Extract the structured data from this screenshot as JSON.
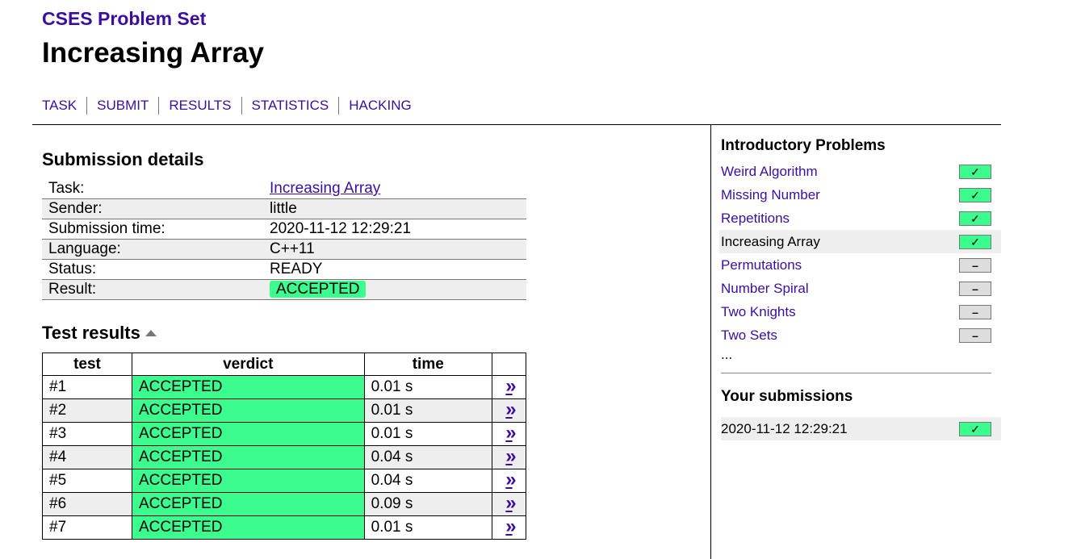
{
  "site": {
    "title": "CSES Problem Set"
  },
  "page": {
    "title": "Increasing Array"
  },
  "nav": [
    "TASK",
    "SUBMIT",
    "RESULTS",
    "STATISTICS",
    "HACKING"
  ],
  "submission": {
    "heading": "Submission details",
    "task_label": "Task:",
    "task_value": "Increasing Array",
    "sender_label": "Sender:",
    "sender_value": "little",
    "time_label": "Submission time:",
    "time_value": "2020-11-12 12:29:21",
    "language_label": "Language:",
    "language_value": "C++11",
    "status_label": "Status:",
    "status_value": "READY",
    "result_label": "Result:",
    "result_value": "ACCEPTED"
  },
  "tests": {
    "heading": "Test results",
    "columns": [
      "test",
      "verdict",
      "time"
    ],
    "rows": [
      {
        "test": "#1",
        "verdict": "ACCEPTED",
        "time": "0.01 s"
      },
      {
        "test": "#2",
        "verdict": "ACCEPTED",
        "time": "0.01 s"
      },
      {
        "test": "#3",
        "verdict": "ACCEPTED",
        "time": "0.01 s"
      },
      {
        "test": "#4",
        "verdict": "ACCEPTED",
        "time": "0.04 s"
      },
      {
        "test": "#5",
        "verdict": "ACCEPTED",
        "time": "0.04 s"
      },
      {
        "test": "#6",
        "verdict": "ACCEPTED",
        "time": "0.09 s"
      },
      {
        "test": "#7",
        "verdict": "ACCEPTED",
        "time": "0.01 s"
      }
    ],
    "details_glyph": "»"
  },
  "sidebar": {
    "heading": "Introductory Problems",
    "problems": [
      {
        "name": "Weird Algorithm",
        "status": "✓"
      },
      {
        "name": "Missing Number",
        "status": "✓"
      },
      {
        "name": "Repetitions",
        "status": "✓"
      },
      {
        "name": "Increasing Array",
        "status": "✓"
      },
      {
        "name": "Permutations",
        "status": "–"
      },
      {
        "name": "Number Spiral",
        "status": "–"
      },
      {
        "name": "Two Knights",
        "status": "–"
      },
      {
        "name": "Two Sets",
        "status": "–"
      }
    ],
    "ellipsis": "...",
    "submissions_heading": "Your submissions",
    "submissions": [
      {
        "time": "2020-11-12 12:29:21",
        "status": "✓"
      }
    ]
  },
  "colors": {
    "accent": "#3a0ea3",
    "accepted": "#3cfc8e"
  }
}
